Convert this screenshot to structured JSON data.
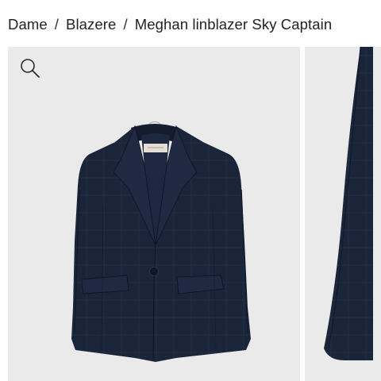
{
  "breadcrumb": {
    "items": [
      {
        "label": "Dame"
      },
      {
        "label": "Blazere"
      },
      {
        "label": "Meghan linblazer Sky Captain"
      }
    ],
    "separator": "/"
  },
  "gallery": {
    "zoom_icon": "search-icon",
    "background_color": "#ebeaeb",
    "product_color": "#1b2539"
  }
}
